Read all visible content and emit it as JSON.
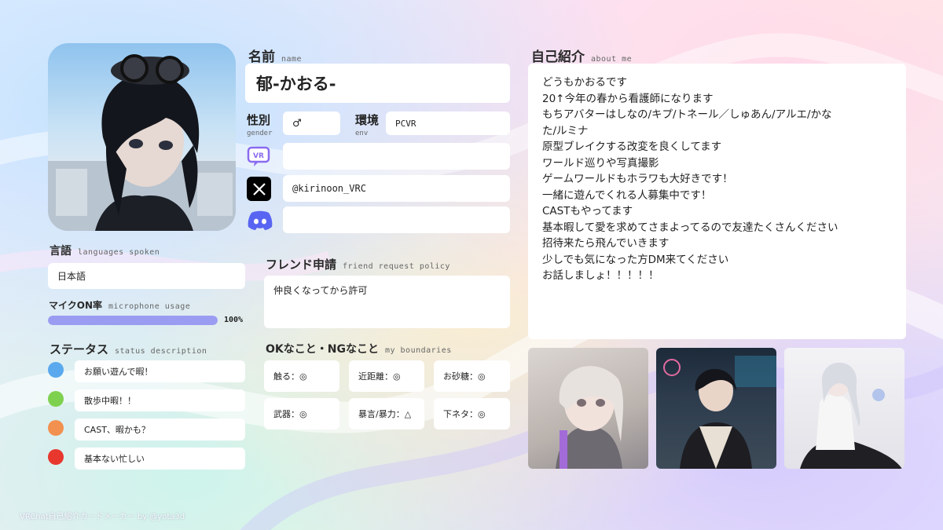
{
  "profile": {
    "name_heading": "名前",
    "name_heading_sub": "name",
    "name": "郁-かおる-",
    "gender_label": "性別",
    "gender_label_sub": "gender",
    "gender": "♂",
    "env_label": "環境",
    "env_label_sub": "env",
    "env": "PCVR",
    "vrchat_id": "",
    "x_account": "@kirinoon_VRC",
    "discord_id": ""
  },
  "languages": {
    "heading": "言語",
    "heading_sub": "languages spoken",
    "value": "日本語"
  },
  "mic": {
    "heading": "マイクON率",
    "heading_sub": "microphone usage",
    "percent_label": "100%",
    "percent": 100,
    "bar_color": "#9a9cf2"
  },
  "status": {
    "heading": "ステータス",
    "heading_sub": "status description",
    "items": [
      {
        "color": "#5aa9ee",
        "text": "お願い遊んで暇！"
      },
      {
        "color": "#7ed14f",
        "text": "散歩中暇！！"
      },
      {
        "color": "#f2914f",
        "text": "CAST、暇かも？"
      },
      {
        "color": "#e8382e",
        "text": "基本ない忙しい"
      }
    ]
  },
  "friend_request": {
    "heading": "フレンド申請",
    "heading_sub": "friend request policy",
    "value": "仲良くなってから許可"
  },
  "boundaries": {
    "heading": "OKなこと・NGなこと",
    "heading_sub": "my boundaries",
    "items": [
      {
        "label": "触る：◎"
      },
      {
        "label": "近距離：◎"
      },
      {
        "label": "お砂糖：◎"
      },
      {
        "label": "武器：◎"
      },
      {
        "label": "暴言/暴力：△"
      },
      {
        "label": "下ネタ：◎"
      }
    ]
  },
  "about": {
    "heading": "自己紹介",
    "heading_sub": "about me",
    "text": "どうもかおるです\n20↑今年の春から看護師になります\nもちアバターはしなの/キプ/トネール／しゅあん/アルエ/かな\nた/ルミナ\n原型ブレイクする改変を良くしてます\nワールド巡りや写真撮影\nゲームワールドもホラワも大好きです！\n一緒に遊んでくれる人募集中です！\nCASTもやってます\n基本暇して愛を求めてさまよってるので友達たくさんください\n招待来たら飛んでいきます\n少しでも気になった方DM来てください\nお話しましょ！！！！！"
  },
  "icons": {
    "vrchat": "vrchat-icon",
    "x": "x-logo-icon",
    "discord": "discord-icon"
  },
  "footer": "VRChat自己紹介カードメーカー by @yota3d"
}
